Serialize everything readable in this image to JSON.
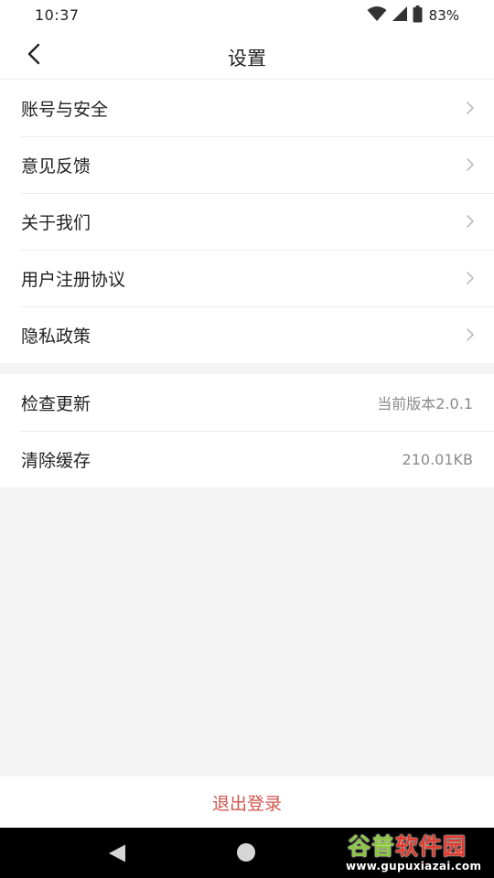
{
  "status_bar": {
    "time": "10:37",
    "battery_percent": "83%",
    "icons": [
      "wifi-icon",
      "cell-signal-icon",
      "battery-icon"
    ]
  },
  "header": {
    "title": "设置",
    "back_icon": "chevron-left-icon"
  },
  "groups": {
    "main": [
      {
        "label": "账号与安全"
      },
      {
        "label": "意见反馈"
      },
      {
        "label": "关于我们"
      },
      {
        "label": "用户注册协议"
      },
      {
        "label": "隐私政策"
      }
    ],
    "system": [
      {
        "label": "检查更新",
        "value": "当前版本2.0.1"
      },
      {
        "label": "清除缓存",
        "value": "210.01KB"
      }
    ]
  },
  "logout": {
    "label": "退出登录",
    "color": "#d0554d"
  },
  "nav_bar": {
    "icons": [
      "nav-back-icon",
      "nav-home-icon"
    ]
  },
  "watermark": {
    "title_part1": "谷普",
    "title_part2": "软件园",
    "url": "www.gupuxiazai.com"
  },
  "colors": {
    "background": "#f4f4f4",
    "surface": "#ffffff",
    "text_primary": "#222222",
    "text_secondary": "#8a8a8a",
    "accent_logout": "#d0554d"
  }
}
